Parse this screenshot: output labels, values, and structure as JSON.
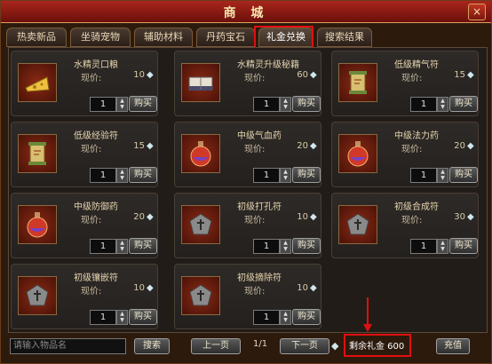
{
  "window": {
    "title": "商 城",
    "close_label": "×"
  },
  "tabs": [
    {
      "label": "热卖新品"
    },
    {
      "label": "坐骑宠物"
    },
    {
      "label": "辅助材料"
    },
    {
      "label": "丹药宝石"
    },
    {
      "label": "礼金兑换",
      "active": true
    },
    {
      "label": "搜索结果"
    }
  ],
  "price_label": "现价:",
  "buy_label": "购买",
  "items": [
    {
      "name": "水精灵口粮",
      "price": "10",
      "qty": "1",
      "icon": "cheese-icon"
    },
    {
      "name": "水精灵升级秘籍",
      "price": "60",
      "qty": "1",
      "icon": "book-icon"
    },
    {
      "name": "低级精气符",
      "price": "15",
      "qty": "1",
      "icon": "scroll-icon"
    },
    {
      "name": "低级经验符",
      "price": "15",
      "qty": "1",
      "icon": "scroll-icon"
    },
    {
      "name": "中级气血药",
      "price": "20",
      "qty": "1",
      "icon": "potion-icon"
    },
    {
      "name": "中级法力药",
      "price": "20",
      "qty": "1",
      "icon": "potion-icon"
    },
    {
      "name": "中级防御药",
      "price": "20",
      "qty": "1",
      "icon": "potion-icon"
    },
    {
      "name": "初级打孔符",
      "price": "10",
      "qty": "1",
      "icon": "rune-icon"
    },
    {
      "name": "初级合成符",
      "price": "30",
      "qty": "1",
      "icon": "rune-icon"
    },
    {
      "name": "初级镶嵌符",
      "price": "10",
      "qty": "1",
      "icon": "rune-icon"
    },
    {
      "name": "初级摘除符",
      "price": "10",
      "qty": "1",
      "icon": "rune-icon"
    }
  ],
  "footer": {
    "search_placeholder": "请输入物品名",
    "search_button": "搜索",
    "prev_button": "上一页",
    "page_indicator": "1/1",
    "next_button": "下一页",
    "balance_text": "剩余礼金 600",
    "recharge_button": "充值"
  },
  "colors": {
    "highlight": "#e01010",
    "title_bar": "#a8261c"
  }
}
